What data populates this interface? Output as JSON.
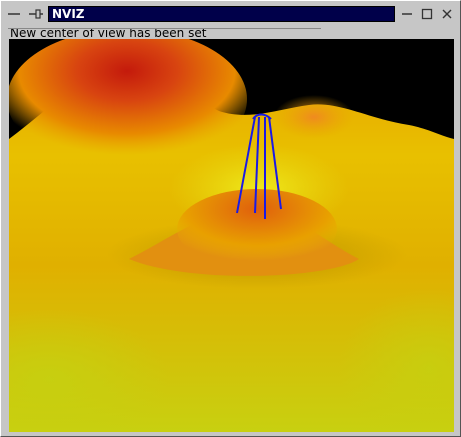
{
  "window": {
    "title": "NVIZ",
    "controls_left": {
      "minimize_icon": "minimize-icon",
      "pin_icon": "pin-icon"
    },
    "controls_right": {
      "minimize_glyph": "—",
      "maximize_glyph": "☐",
      "close_glyph": "✕"
    }
  },
  "status": {
    "message": "New center of view has been set"
  },
  "scene": {
    "background_color": "#000000",
    "surface_low_color": "#d6e010",
    "surface_mid_color": "#e8a800",
    "surface_peak_color": "#c42010",
    "marker_color": "#1a1ae6"
  }
}
